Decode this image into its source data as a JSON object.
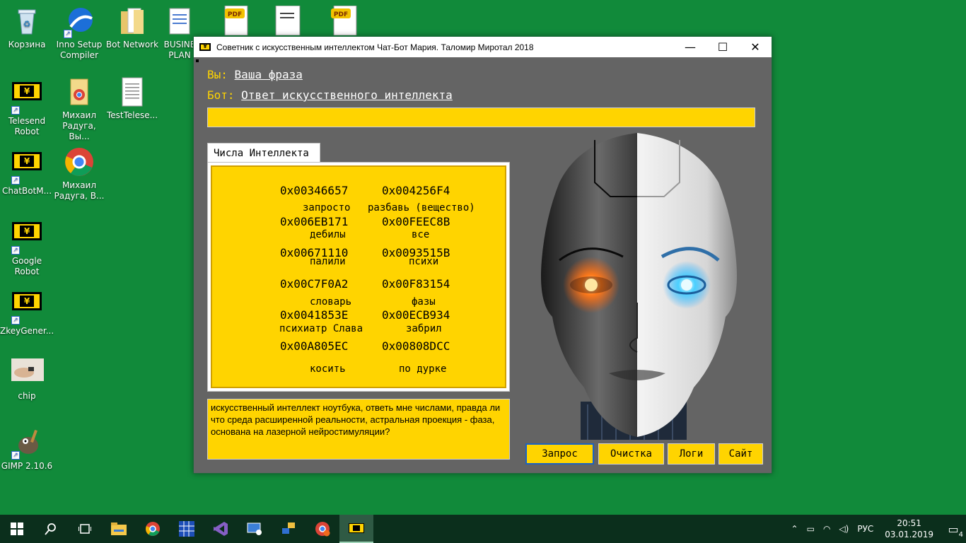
{
  "desktop": {
    "icons": [
      {
        "label": "Корзина",
        "icon": "recycle-bin-icon"
      },
      {
        "label": "Inno Setup Compiler",
        "icon": "inno-setup-icon"
      },
      {
        "label": "Bot Network",
        "icon": "folder-icon"
      },
      {
        "label": "BUSINE PLAN",
        "icon": "document-icon"
      },
      {
        "label": "Telesend Robot",
        "icon": "yen-app-icon"
      },
      {
        "label": "Михаил Радуга, Вы...",
        "icon": "chrome-folder-icon"
      },
      {
        "label": "TestTelese...",
        "icon": "text-file-icon"
      },
      {
        "label": "ChatBotM...",
        "icon": "yen-app-icon"
      },
      {
        "label": "Михаил Радуга, В...",
        "icon": "chrome-icon"
      },
      {
        "label": "Google Robot",
        "icon": "yen-app-icon"
      },
      {
        "label": "ZkeyGener...",
        "icon": "yen-app-icon"
      },
      {
        "label": "chip",
        "icon": "image-icon"
      },
      {
        "label": "GIMP 2.10.6",
        "icon": "gimp-icon"
      }
    ]
  },
  "window": {
    "title": "Советник с искусственным интеллектом Чат-Бот Мария. Таломир Миротал 2018",
    "minimize": "—",
    "maximize": "☐",
    "close": "✕",
    "you_label": "Вы:",
    "you_value": "Ваша фраза",
    "bot_label": "Бот:",
    "bot_value": "Ответ искусственного интеллекта",
    "tab_label": "Числа Интеллекта",
    "grid": [
      {
        "num1": "0x00346657",
        "num2": "0x004256F4",
        "word1": "запросто",
        "word2": "разбавь (вещество)"
      },
      {
        "num1": "0x006EB171",
        "num2": "0x00FEEC8B",
        "word1": "дебилы",
        "word2": "все"
      },
      {
        "num1": "0x00671110",
        "num2": "0x0093515B",
        "word1": "палили",
        "word2": "психи"
      },
      {
        "num1": "0x00C7F0A2",
        "num2": "0x00F83154",
        "word1": "словарь",
        "word2": "фазы"
      },
      {
        "num1": "0x0041853E",
        "num2": "0x00ECB934",
        "word1": "психиатр Слава",
        "word2": "забрил"
      },
      {
        "num1": "0x00A805EC",
        "num2": "0x00808DCC",
        "word1": "косить",
        "word2": "по дурке"
      }
    ],
    "query_text": "искусственный интеллект ноутбука, ответь мне числами, правда ли что среда расширенной реальности, астральная проекция - фаза, основана на лазерной нейростимуляции?",
    "buttons": {
      "query": "Запрос",
      "clear": "Очистка",
      "logs": "Логи",
      "site": "Сайт"
    }
  },
  "taskbar": {
    "lang": "РУС",
    "time": "20:51",
    "date": "03.01.2019",
    "notifications": "4"
  },
  "colors": {
    "desktop": "#118a3a",
    "window_bg": "#646464",
    "accent_yellow": "#ffd400"
  }
}
